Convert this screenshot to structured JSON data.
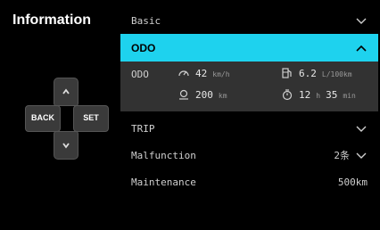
{
  "header": {
    "title": "Information"
  },
  "dpad": {
    "back_label": "BACK",
    "set_label": "SET"
  },
  "menu": {
    "basic": {
      "label": "Basic"
    },
    "odo": {
      "label": "ODO",
      "panel_label": "ODO",
      "speed": {
        "value": "42",
        "unit": "km/h",
        "icon": "speedometer-icon"
      },
      "fuel": {
        "value": "6.2",
        "unit": "L/100km",
        "icon": "fuel-pump-icon"
      },
      "distance": {
        "value": "200",
        "unit": "km",
        "icon": "location-pin-icon"
      },
      "time": {
        "hours": "12",
        "h_unit": "h",
        "minutes": "35",
        "m_unit": "min",
        "icon": "stopwatch-icon"
      }
    },
    "trip": {
      "label": "TRIP"
    },
    "malfunction": {
      "label": "Malfunction",
      "count": "2条"
    },
    "maintenance": {
      "label": "Maintenance",
      "value": "500km"
    }
  },
  "colors": {
    "accent": "#1ed2ee",
    "panel": "#323232",
    "background": "#000000"
  }
}
